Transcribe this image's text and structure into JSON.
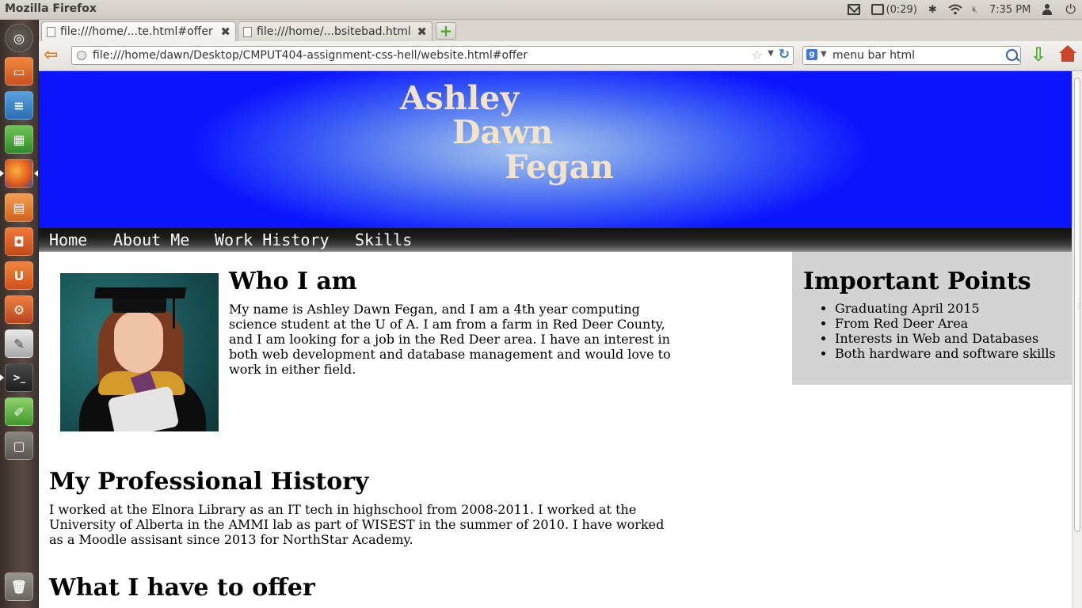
{
  "window": {
    "app_title": "Mozilla Firefox"
  },
  "tray": {
    "battery_time": "(0:29)",
    "clock": "7:35 PM"
  },
  "launcher": {
    "items": [
      "dash-home",
      "files",
      "writer",
      "calc",
      "firefox",
      "impress",
      "software-center",
      "ubuntu-one",
      "system-settings",
      "text-editor",
      "terminal",
      "draw",
      "workspaces",
      "trash"
    ]
  },
  "tabs": [
    {
      "label": "file:///home/...te.html#offer",
      "active": true
    },
    {
      "label": "file:///home/...bsitebad.html",
      "active": false
    }
  ],
  "navbar": {
    "url": "file:///home/dawn/Desktop/CMPUT404-assignment-css-hell/website.html#offer",
    "search": "menu bar html"
  },
  "page": {
    "banner": {
      "first": "Ashley",
      "middle": "Dawn",
      "last": "Fegan"
    },
    "menu": [
      "Home",
      "About Me",
      "Work History",
      "Skills"
    ],
    "who": {
      "title": "Who I am",
      "body": "My name is Ashley Dawn Fegan, and I am a 4th year computing science student at the U of A. I am from a farm in Red Deer County, and I am looking for a job in the Red Deer area. I have an interest in both web development and database management and would love to work in either field."
    },
    "important": {
      "title": "Important Points",
      "items": [
        "Graduating April 2015",
        "From Red Deer Area",
        "Interests in Web and Databases",
        "Both hardware and software skills"
      ]
    },
    "history": {
      "title": "My Professional History",
      "body": "I worked at the Elnora Library as an IT tech in highschool from 2008-2011. I worked at the University of Alberta in the AMMI lab as part of WISEST in the summer of 2010. I have worked as a Moodle assisant since 2013 for NorthStar Academy."
    },
    "offer": {
      "title": "What I have to offer"
    }
  },
  "colors": {
    "banner_edge": "#0a14ff",
    "banner_center": "#a8c5ee",
    "name_color": "#f3e3c8",
    "aside_bg": "#d3d3d3"
  }
}
